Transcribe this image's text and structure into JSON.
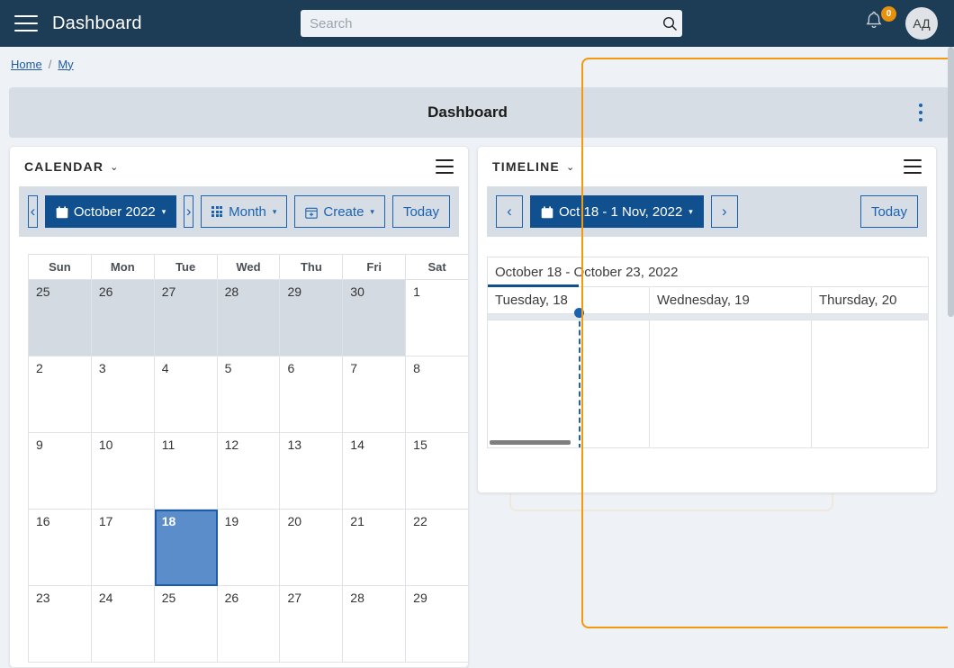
{
  "navbar": {
    "menu_icon": "hamburger-icon",
    "title": "Dashboard",
    "search": {
      "value": "",
      "placeholder": "Search",
      "icon": "search-icon"
    },
    "notifications": {
      "icon": "bell-icon",
      "count": "0",
      "badge_color": "#e8910c"
    },
    "avatar": {
      "initials": "АД"
    },
    "bg_color": "#1d3c56"
  },
  "breadcrumb": {
    "items": [
      "Home",
      "My"
    ],
    "separator": "/"
  },
  "page": {
    "title": "Dashboard",
    "kebab_icon": "vertical-dots-icon",
    "highlight_color": "#f2990d"
  },
  "calendar_widget": {
    "title": "CALENDAR",
    "title_caret": "⌄",
    "menu_icon": "hamburger-menu-icon",
    "toolbar": {
      "prev_label": "‹",
      "period_label": "October 2022",
      "period_caret": "▾",
      "next_label": "›",
      "view_label": "Month",
      "view_caret": "▾",
      "create_label": "Create",
      "create_caret": "▾",
      "today_label": "Today"
    },
    "day_headers": [
      "Sun",
      "Mon",
      "Tue",
      "Wed",
      "Thu",
      "Fri",
      "Sat"
    ],
    "weeks": [
      [
        {
          "d": "25",
          "other": true
        },
        {
          "d": "26",
          "other": true
        },
        {
          "d": "27",
          "other": true
        },
        {
          "d": "28",
          "other": true
        },
        {
          "d": "29",
          "other": true
        },
        {
          "d": "30",
          "other": true
        },
        {
          "d": "1",
          "other": false
        }
      ],
      [
        {
          "d": "2"
        },
        {
          "d": "3"
        },
        {
          "d": "4"
        },
        {
          "d": "5"
        },
        {
          "d": "6"
        },
        {
          "d": "7"
        },
        {
          "d": "8"
        }
      ],
      [
        {
          "d": "9"
        },
        {
          "d": "10"
        },
        {
          "d": "11"
        },
        {
          "d": "12"
        },
        {
          "d": "13"
        },
        {
          "d": "14"
        },
        {
          "d": "15"
        }
      ],
      [
        {
          "d": "16"
        },
        {
          "d": "17"
        },
        {
          "d": "18",
          "selected": true
        },
        {
          "d": "19"
        },
        {
          "d": "20"
        },
        {
          "d": "21"
        },
        {
          "d": "22"
        }
      ],
      [
        {
          "d": "23"
        },
        {
          "d": "24"
        },
        {
          "d": "25"
        },
        {
          "d": "26"
        },
        {
          "d": "27"
        },
        {
          "d": "28"
        },
        {
          "d": "29"
        }
      ]
    ],
    "selected_day": "18",
    "selected_bg": "#5b8dca",
    "selected_border": "#1c5ba6"
  },
  "timeline_widget": {
    "title": "TIMELINE",
    "title_caret": "⌄",
    "menu_icon": "hamburger-menu-icon",
    "toolbar": {
      "prev_label": "‹",
      "period_label": "Oct 18 - 1 Nov, 2022",
      "period_caret": "▾",
      "next_label": "›",
      "today_label": "Today"
    },
    "range_header": "October 18 - October 23, 2022",
    "day_columns": [
      "Tuesday, 18",
      "Wednesday, 19",
      "Thursday, 20"
    ],
    "now_indicator_color": "#1b63b0"
  }
}
